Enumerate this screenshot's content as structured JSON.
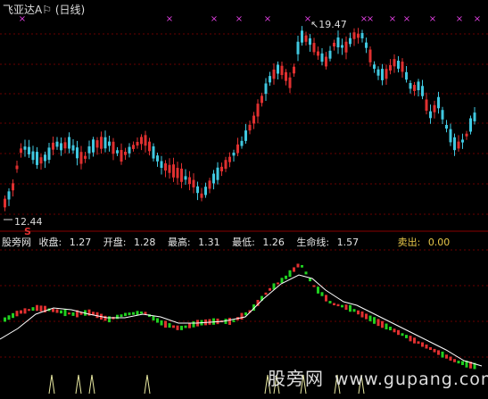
{
  "window": {
    "title": "飞亚达A",
    "period": "(日线)",
    "flag_icon": "flag-icon"
  },
  "main_chart": {
    "high_label": "19.47",
    "low_label": "12.44",
    "signal_letter": "S",
    "x_marker_glyph": "×",
    "colors": {
      "up": "#e03030",
      "down": "#40c8e0",
      "x_marker": "#e040e0",
      "grid": "#6a0000"
    }
  },
  "indicator": {
    "name": "股旁网",
    "close_label": "收盘:",
    "close_value": "1.27",
    "open_label": "开盘:",
    "open_value": "1.28",
    "high_label": "最高:",
    "high_value": "1.31",
    "low_label": "最低:",
    "low_value": "1.26",
    "lifeline_label": "生命线:",
    "lifeline_value": "1.57",
    "sell_label": "卖出:",
    "sell_value": "0.00",
    "colors": {
      "up": "#e03030",
      "down": "#20d020",
      "lifeline": "#ffffff",
      "sell_signal": "#e8e8a0"
    }
  },
  "watermark": {
    "text": "股旁网",
    "url": "www.gupang.com"
  }
}
